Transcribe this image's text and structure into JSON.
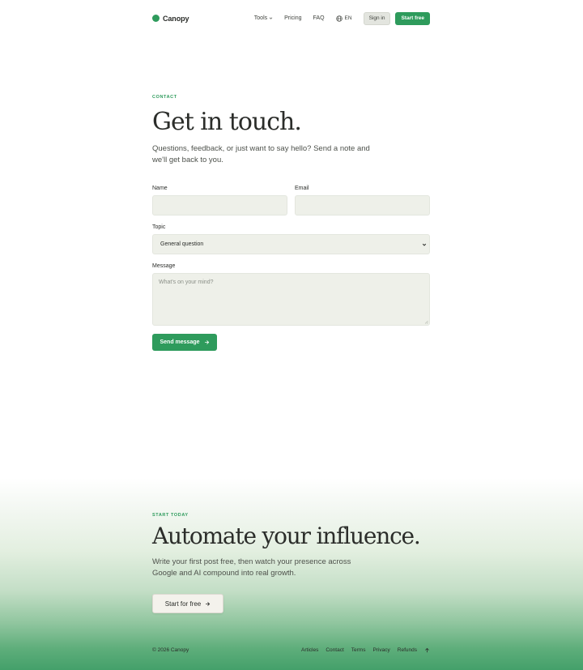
{
  "header": {
    "brand": "Canopy",
    "nav": [
      {
        "label": "Tools"
      },
      {
        "label": "Pricing"
      },
      {
        "label": "FAQ"
      }
    ],
    "language": "EN",
    "sign_in": "Sign in",
    "start_free": "Start free"
  },
  "contact": {
    "eyebrow": "CONTACT",
    "title": "Get in touch.",
    "lede": "Questions, feedback, or just want to say hello? Send a note and we'll get back to you.",
    "form": {
      "name_label": "Name",
      "name_value": "",
      "email_label": "Email",
      "email_value": "",
      "topic_label": "Topic",
      "topic_selected": "General question",
      "message_label": "Message",
      "message_placeholder": "What's on your mind?",
      "submit": "Send message"
    }
  },
  "cta": {
    "eyebrow": "START TODAY",
    "title": "Automate your influence.",
    "lede": "Write your first post free, then watch your presence across Google and AI compound into real growth.",
    "button": "Start for free"
  },
  "footer": {
    "copyright": "© 2026 Canopy",
    "links": [
      "Articles",
      "Contact",
      "Terms",
      "Privacy",
      "Refunds"
    ]
  },
  "colors": {
    "accent": "#2e9b5c",
    "field_bg": "#eef0e9",
    "text": "#2b2d2a"
  },
  "icons": {
    "brand": "green-dot-logo-icon",
    "tools_menu": "chevron-down-icon",
    "language": "globe-icon",
    "select": "chevron-down-icon",
    "send": "arrow-right-icon",
    "cta": "arrow-right-icon",
    "back_to_top": "arrow-up-icon"
  }
}
